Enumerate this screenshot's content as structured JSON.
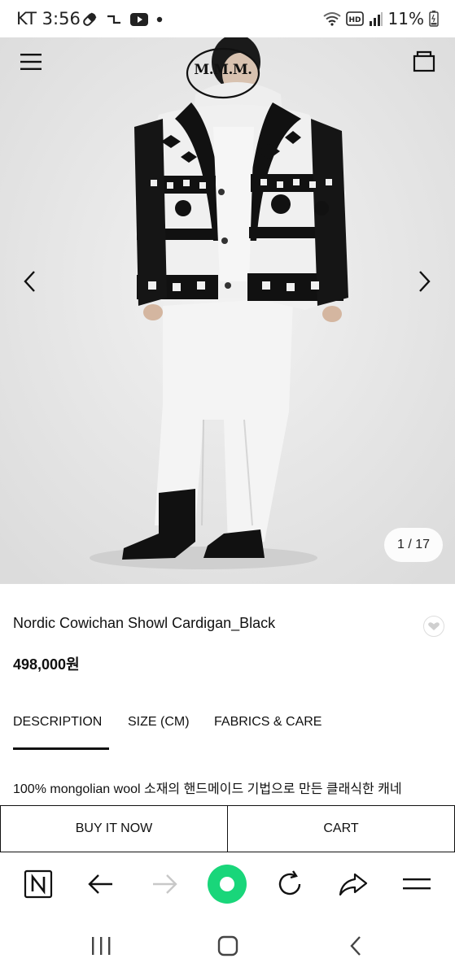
{
  "status_bar": {
    "time": "KT 3:56",
    "battery": "11%",
    "icons": [
      "pill-icon",
      "link-icon",
      "youtube-icon",
      "dot-icon",
      "wifi-icon",
      "hd-icon",
      "signal-icon",
      "battery-icon"
    ]
  },
  "header": {
    "logo_text": "M.M.M.",
    "menu_icon": "hamburger-menu-icon",
    "bag_icon": "shopping-bag-icon"
  },
  "gallery": {
    "current": "1",
    "separator": "/",
    "total": "17",
    "counter_text": "1 / 17",
    "prev_icon": "chevron-left-icon",
    "next_icon": "chevron-right-icon"
  },
  "product": {
    "name": "Nordic Cowichan Showl Cardigan_Black",
    "price": "498,000원",
    "wish_icon": "heart-icon"
  },
  "tabs": [
    {
      "label": "DESCRIPTION",
      "active": true
    },
    {
      "label": "SIZE (CM)",
      "active": false
    },
    {
      "label": "FABRICS & CARE",
      "active": false
    }
  ],
  "description": {
    "line1": "100% mongolian wool 소재의 핸드메이드 기법으로 만든 클래식한 캐네"
  },
  "actions": {
    "buy_now": "BUY IT NOW",
    "cart": "CART"
  },
  "browser_toolbar": {
    "icons": [
      "naver-n-icon",
      "back-arrow-icon",
      "forward-arrow-icon",
      "green-home-icon",
      "refresh-icon",
      "share-icon",
      "menu-lines-icon"
    ],
    "accent": "#19d67a"
  },
  "system_nav": {
    "icons": [
      "recent-apps-icon",
      "home-icon",
      "back-icon"
    ]
  }
}
